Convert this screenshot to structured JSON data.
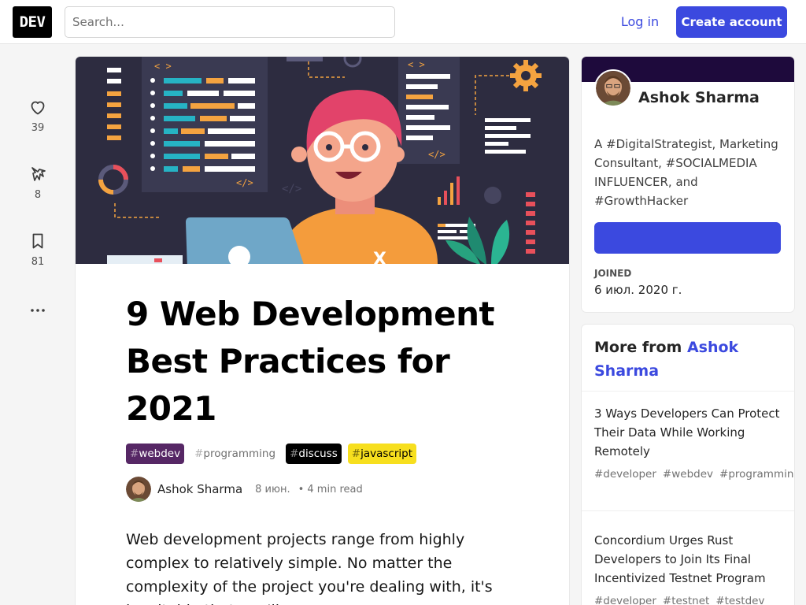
{
  "header": {
    "logo": "DEV",
    "search_placeholder": "Search...",
    "login_label": "Log in",
    "create_account_label": "Create account"
  },
  "reactions": [
    {
      "icon": "heart-icon",
      "count": "39"
    },
    {
      "icon": "unicorn-icon",
      "count": "8"
    },
    {
      "icon": "bookmark-icon",
      "count": "81"
    }
  ],
  "more_icon": "more-horizontal-icon",
  "article": {
    "title": "9 Web Development Best Practices for 2021",
    "tags": [
      {
        "hash": "#",
        "name": "webdev",
        "bg": "#562765",
        "fg": "#ffffff"
      },
      {
        "hash": "#",
        "name": "programming",
        "bg": "#ffffff",
        "fg": "#717171"
      },
      {
        "hash": "#",
        "name": "discuss",
        "bg": "#000000",
        "fg": "#ffffff"
      },
      {
        "hash": "#",
        "name": "javascript",
        "bg": "#f7df1e",
        "fg": "#000000"
      }
    ],
    "author": "Ashok Sharma",
    "date": "8 июн.",
    "read_time": "• 4 min read",
    "body": "Web development projects range from highly complex to relatively simple. No matter the complexity of the project you're dealing with, it's inevitable that you'll"
  },
  "profile": {
    "name": "Ashok Sharma",
    "bio": "A #DigitalStrategist, Marketing Consultant, #SOCIALMEDIA INFLUENCER, and #GrowthHacker",
    "joined_label": "JOINED",
    "joined_value": "6 июл. 2020 г."
  },
  "more_from": {
    "prefix": "More from",
    "author": "Ashok Sharma",
    "items": [
      {
        "title": "3 Ways Developers Can Protect Their Data While Working Remotely",
        "tags": [
          "#developer",
          "#webdev",
          "#programming"
        ]
      },
      {
        "title": "Concordium Urges Rust Developers to Join Its Final Incentivized Testnet Program",
        "tags": [
          "#developer",
          "#testnet",
          "#testdev"
        ]
      }
    ]
  },
  "colors": {
    "accent": "#3b49df",
    "cover_bg": "#2d2c40",
    "profile_band": "#1e0a3c"
  }
}
